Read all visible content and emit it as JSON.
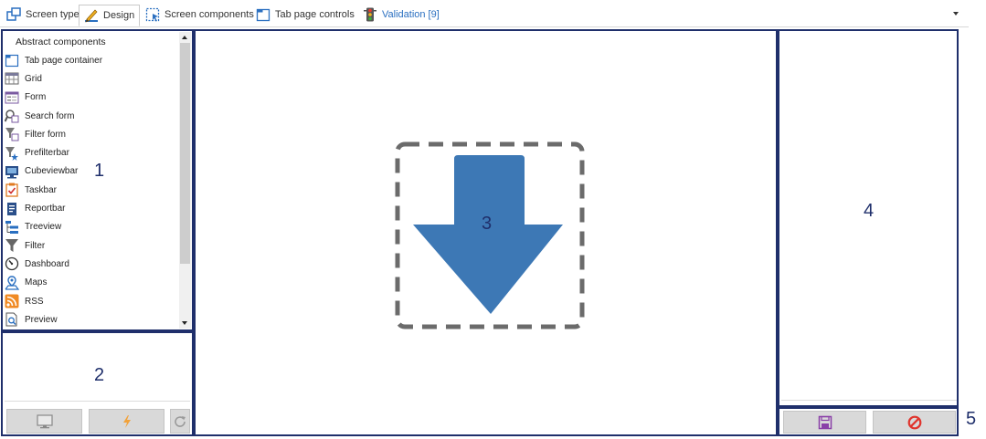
{
  "tabs": [
    {
      "label": "Screen type",
      "icon": "screen-type-icon"
    },
    {
      "label": "Design",
      "icon": "design-pencil-icon"
    },
    {
      "label": "Screen components",
      "icon": "screen-components-icon"
    },
    {
      "label": "Tab page controls",
      "icon": "tab-page-controls-icon"
    },
    {
      "label": "Validation [9]",
      "icon": "traffic-light-icon"
    }
  ],
  "active_tab": "Design",
  "colors": {
    "panel_border": "#1f2f6b",
    "arrow": "#3d78b5",
    "validation_link": "#2a6fc0",
    "dashed": "#6b6b6b"
  },
  "components": {
    "header": "Abstract components",
    "items": [
      {
        "label": "Tab page container",
        "icon": "tab-page-container-icon"
      },
      {
        "label": "Grid",
        "icon": "grid-icon"
      },
      {
        "label": "Form",
        "icon": "form-icon"
      },
      {
        "label": "Search form",
        "icon": "search-form-icon"
      },
      {
        "label": "Filter form",
        "icon": "filter-form-icon"
      },
      {
        "label": "Prefilterbar",
        "icon": "prefilterbar-icon"
      },
      {
        "label": "Cubeviewbar",
        "icon": "cubeviewbar-icon"
      },
      {
        "label": "Taskbar",
        "icon": "taskbar-icon"
      },
      {
        "label": "Reportbar",
        "icon": "reportbar-icon"
      },
      {
        "label": "Treeview",
        "icon": "treeview-icon"
      },
      {
        "label": "Filter",
        "icon": "filter-icon"
      },
      {
        "label": "Dashboard",
        "icon": "dashboard-icon"
      },
      {
        "label": "Maps",
        "icon": "maps-icon"
      },
      {
        "label": "RSS",
        "icon": "rss-icon"
      },
      {
        "label": "Preview",
        "icon": "preview-icon"
      }
    ]
  },
  "callouts": {
    "one": "1",
    "two": "2",
    "three": "3",
    "four": "4",
    "five": "5"
  },
  "panel2_buttons": [
    "monitor-icon",
    "lightning-icon",
    "refresh-icon"
  ],
  "panel5_buttons": [
    "save-icon",
    "cancel-icon"
  ]
}
